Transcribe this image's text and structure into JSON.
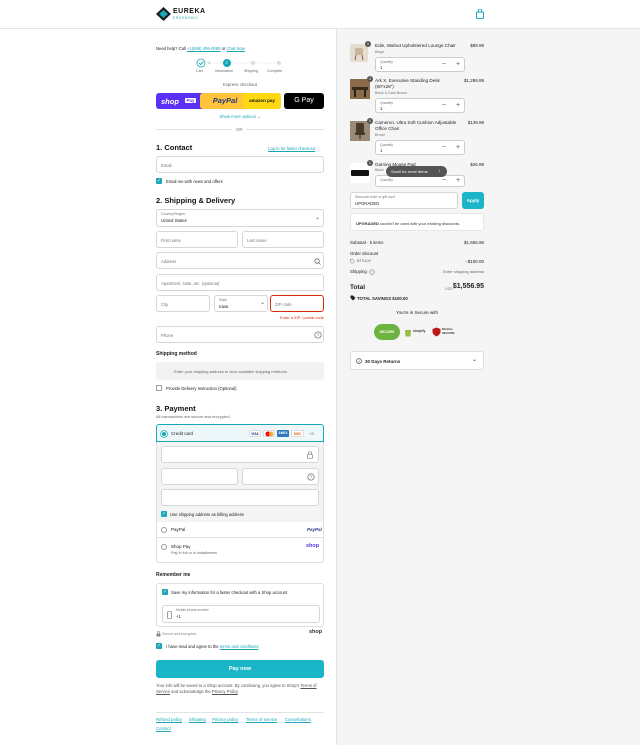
{
  "brand": {
    "name": "EUREKA",
    "sub": "ERGONOMIC"
  },
  "help": {
    "text": "Need help? Call",
    "phone": "+1(866) 406-0089",
    "or": "or",
    "chat": "Chat Now"
  },
  "steps": [
    {
      "num": "1",
      "label": "Cart"
    },
    {
      "num": "2",
      "label": "Information"
    },
    {
      "num": "3",
      "label": "Shipping"
    },
    {
      "num": "4",
      "label": "Complete"
    }
  ],
  "express": {
    "title": "Express checkout",
    "shop_pay": "shop",
    "shop_pay_badge": "Pay",
    "paypal": "PayPal",
    "amazon": "amazon pay",
    "gpay": "G Pay",
    "more": "Show more options",
    "or": "OR"
  },
  "contact": {
    "heading": "1. Contact",
    "login": "Log in for faster checkout",
    "email_placeholder": "Email",
    "news": "Email me with news and offers"
  },
  "shipping": {
    "heading": "2. Shipping & Delivery",
    "country_label": "Country/Region",
    "country": "United States",
    "first": "First name",
    "last": "Last name",
    "address": "Address",
    "apt": "Apartment, suite, etc. (optional)",
    "city": "City",
    "state_label": "State",
    "state": "Iowa",
    "zip": "ZIP code",
    "zip_error": "Enter a ZIP / postal code",
    "phone": "Phone"
  },
  "shipping_method": {
    "heading": "Shipping method",
    "info": "Enter your shipping address to view available shipping methods.",
    "instruction": "Provide Delivery Instruction (Optional)"
  },
  "payment": {
    "heading": "3. Payment",
    "subtitle": "All transactions are secure and encrypted.",
    "credit": "Credit card",
    "cards": [
      "VISA",
      "MC",
      "AMEX",
      "DISC"
    ],
    "more_cards": "+3",
    "billing": "Use shipping address as billing address",
    "paypal": "PayPal",
    "paypal_logo": "PayPal",
    "shoppay": "Shop Pay",
    "shoppay_sub": "Pay in full or in installments",
    "shoppay_logo": "shop"
  },
  "remember": {
    "heading": "Remember me",
    "save": "Save my information for a faster checkout with a Shop account",
    "phone_label": "Mobile phone number",
    "phone_val": "+1",
    "secure": "Secure and encrypted",
    "shop": "shop"
  },
  "terms": {
    "text": "I have read and agree to the",
    "link": "terms and conditions"
  },
  "paynow": "Pay now",
  "disclaimer": {
    "line1": "Your info will be saved to a Shop account. By continuing, you agree to Shop's",
    "tos": "Terms of Service",
    "mid": "and acknowledge the",
    "privacy": "Privacy Policy",
    "end": "."
  },
  "footer": [
    "Refund policy",
    "Shipping",
    "Privacy policy",
    "Terms of service",
    "Cancellations",
    "Contact"
  ],
  "items": [
    {
      "qty": "1",
      "name": "Edie, Walnut Upholstered Lounge Chair",
      "variant": "Beige",
      "price": "$89.99",
      "qty_label": "Quantity",
      "qty_val": "1"
    },
    {
      "qty": "1",
      "name": "Ark X, Executive Standing Desk (60\"x26\")",
      "variant": "Black & Dark Brown",
      "price": "$1,299.99",
      "qty_label": "Quantity",
      "qty_val": "1"
    },
    {
      "qty": "1",
      "name": "Cameron, Ultra Soft Cushion Adjustable Office Chair",
      "variant": "Brown",
      "price": "$139.99",
      "qty_label": "Quantity",
      "qty_val": "1"
    },
    {
      "qty": "1",
      "name": "Gaming Mouse Pad",
      "variant": "Black",
      "price": "$26.99",
      "qty_label": "Quantity",
      "qty_val": "1"
    }
  ],
  "scroll_pill": "Scroll for more items",
  "discount": {
    "label": "Discount code or gift card",
    "value": "UPGRADED",
    "apply": "Apply",
    "error_bold": "UPGRADED",
    "error_rest": "couldn't be used with your existing discounts."
  },
  "summary": {
    "subtotal_label": "Subtotal · 5 items",
    "subtotal": "$1,656.95",
    "order_discount": "Order discount",
    "code": "BTS100",
    "discount_amount": "−$100.00",
    "shipping_label": "Shipping",
    "shipping_val": "Enter shipping address",
    "total_label": "Total",
    "currency": "USD",
    "total": "$1,556.95",
    "savings_label": "TOTAL SAVINGS",
    "savings": "$100.00"
  },
  "secure": {
    "title": "You're in Secure with",
    "badges": [
      "SECURE",
      "shopify",
      "McAfee SECURE"
    ]
  },
  "returns": "30 Days Returns",
  "colors": {
    "accent": "#1aa6b7",
    "shoppay": "#5a31f4",
    "paypal": "#ffc439",
    "amazon": "#ffd814",
    "error": "#d72c0d"
  }
}
